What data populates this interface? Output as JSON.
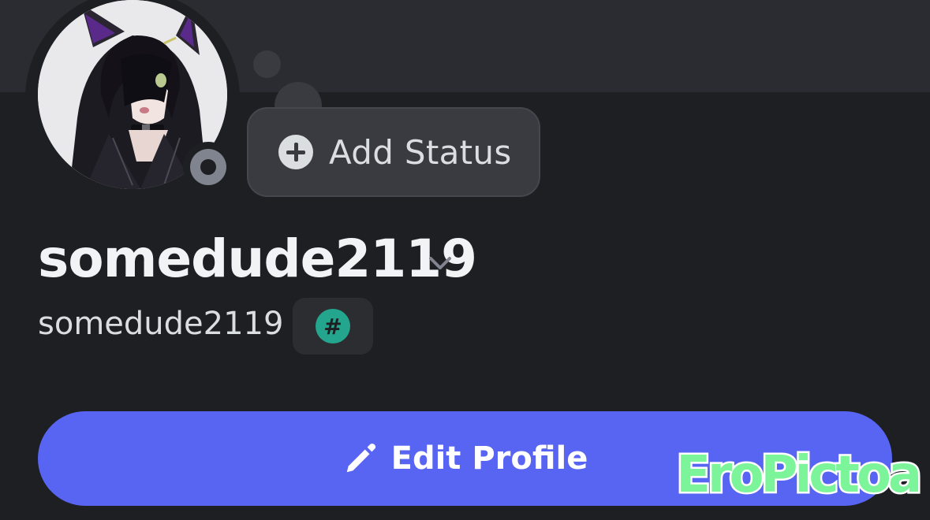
{
  "profile": {
    "display_name": "somedude2119",
    "username": "somedude2119",
    "presence": "offline",
    "avatar_description": "anime-avatar",
    "badge": {
      "icon": "hashtag-badge-icon",
      "glyph": "#",
      "color": "#23a58e"
    }
  },
  "status": {
    "label": "Add Status"
  },
  "actions": {
    "edit_profile_label": "Edit Profile"
  },
  "colors": {
    "background": "#1e1f22",
    "banner": "#2a2c31",
    "accent": "#5865f2",
    "status_pill": "#393b41",
    "presence_offline": "#80848e"
  },
  "watermark": {
    "text": "EroPictoa"
  }
}
